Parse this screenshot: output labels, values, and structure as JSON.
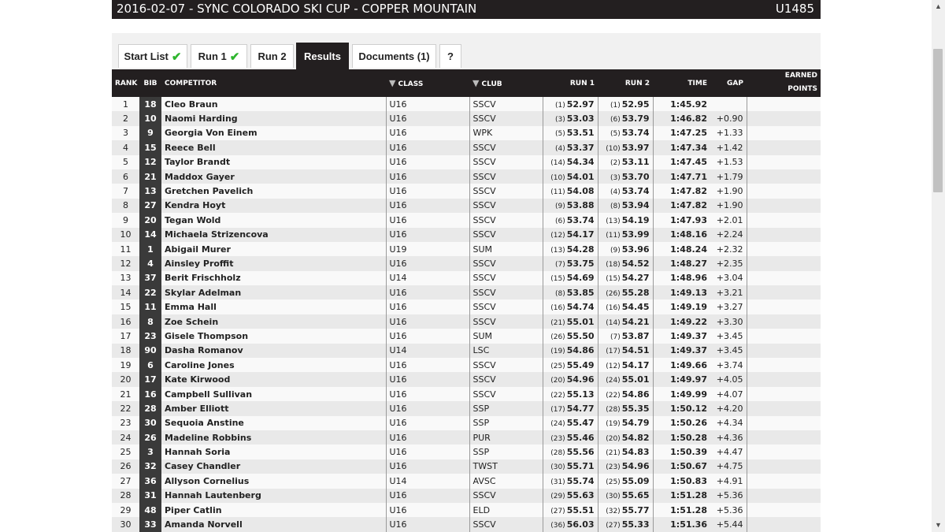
{
  "header": {
    "title": "2016-02-07 - SYNC COLORADO SKI CUP - COPPER MOUNTAIN",
    "code": "U1485"
  },
  "tabs": [
    {
      "label": "Start List",
      "check": "✔",
      "active": false
    },
    {
      "label": "Run 1",
      "check": "✔",
      "active": false
    },
    {
      "label": "Run 2",
      "check": "",
      "active": false
    },
    {
      "label": "Results",
      "check": "",
      "active": true
    },
    {
      "label": "Documents (1)",
      "check": "",
      "active": false
    },
    {
      "label": "?",
      "check": "",
      "active": false
    }
  ],
  "columns": {
    "rank": "RANK",
    "bib": "BIB",
    "competitor": "COMPETITOR",
    "class": "CLASS",
    "club": "CLUB",
    "run1": "RUN 1",
    "run2": "RUN 2",
    "time": "TIME",
    "gap": "GAP",
    "points_line1": "EARNED",
    "points_line2": "POINTS"
  },
  "icons": {
    "filter": "filter-funnel-icon",
    "check": "checkmark-icon"
  },
  "colors": {
    "header_bg": "#231f20",
    "check_green": "#2db52d",
    "bib_bg": "#3a3a3a"
  },
  "rows": [
    {
      "rank": "1",
      "bib": "18",
      "name": "Cleo Braun",
      "cls": "U16",
      "club": "SSCV",
      "r1p": "(1)",
      "r1": "52.97",
      "r2p": "(1)",
      "r2": "52.95",
      "time": "1:45.92",
      "gap": ""
    },
    {
      "rank": "2",
      "bib": "10",
      "name": "Naomi Harding",
      "cls": "U16",
      "club": "SSCV",
      "r1p": "(3)",
      "r1": "53.03",
      "r2p": "(6)",
      "r2": "53.79",
      "time": "1:46.82",
      "gap": "+0.90"
    },
    {
      "rank": "3",
      "bib": "9",
      "name": "Georgia Von Einem",
      "cls": "U16",
      "club": "WPK",
      "r1p": "(5)",
      "r1": "53.51",
      "r2p": "(5)",
      "r2": "53.74",
      "time": "1:47.25",
      "gap": "+1.33"
    },
    {
      "rank": "4",
      "bib": "15",
      "name": "Reece Bell",
      "cls": "U16",
      "club": "SSCV",
      "r1p": "(4)",
      "r1": "53.37",
      "r2p": "(10)",
      "r2": "53.97",
      "time": "1:47.34",
      "gap": "+1.42"
    },
    {
      "rank": "5",
      "bib": "12",
      "name": "Taylor Brandt",
      "cls": "U16",
      "club": "SSCV",
      "r1p": "(14)",
      "r1": "54.34",
      "r2p": "(2)",
      "r2": "53.11",
      "time": "1:47.45",
      "gap": "+1.53"
    },
    {
      "rank": "6",
      "bib": "21",
      "name": "Maddox Gayer",
      "cls": "U16",
      "club": "SSCV",
      "r1p": "(10)",
      "r1": "54.01",
      "r2p": "(3)",
      "r2": "53.70",
      "time": "1:47.71",
      "gap": "+1.79"
    },
    {
      "rank": "7",
      "bib": "13",
      "name": "Gretchen Pavelich",
      "cls": "U16",
      "club": "SSCV",
      "r1p": "(11)",
      "r1": "54.08",
      "r2p": "(4)",
      "r2": "53.74",
      "time": "1:47.82",
      "gap": "+1.90"
    },
    {
      "rank": "8",
      "bib": "27",
      "name": "Kendra Hoyt",
      "cls": "U16",
      "club": "SSCV",
      "r1p": "(9)",
      "r1": "53.88",
      "r2p": "(8)",
      "r2": "53.94",
      "time": "1:47.82",
      "gap": "+1.90"
    },
    {
      "rank": "9",
      "bib": "20",
      "name": "Tegan Wold",
      "cls": "U16",
      "club": "SSCV",
      "r1p": "(6)",
      "r1": "53.74",
      "r2p": "(13)",
      "r2": "54.19",
      "time": "1:47.93",
      "gap": "+2.01"
    },
    {
      "rank": "10",
      "bib": "14",
      "name": "Michaela Strizencova",
      "cls": "U16",
      "club": "SSCV",
      "r1p": "(12)",
      "r1": "54.17",
      "r2p": "(11)",
      "r2": "53.99",
      "time": "1:48.16",
      "gap": "+2.24"
    },
    {
      "rank": "11",
      "bib": "1",
      "name": "Abigail Murer",
      "cls": "U19",
      "club": "SUM",
      "r1p": "(13)",
      "r1": "54.28",
      "r2p": "(9)",
      "r2": "53.96",
      "time": "1:48.24",
      "gap": "+2.32"
    },
    {
      "rank": "12",
      "bib": "4",
      "name": "Ainsley Proffit",
      "cls": "U16",
      "club": "SSCV",
      "r1p": "(7)",
      "r1": "53.75",
      "r2p": "(18)",
      "r2": "54.52",
      "time": "1:48.27",
      "gap": "+2.35"
    },
    {
      "rank": "13",
      "bib": "37",
      "name": "Berit Frischholz",
      "cls": "U14",
      "club": "SSCV",
      "r1p": "(15)",
      "r1": "54.69",
      "r2p": "(15)",
      "r2": "54.27",
      "time": "1:48.96",
      "gap": "+3.04"
    },
    {
      "rank": "14",
      "bib": "22",
      "name": "Skylar Adelman",
      "cls": "U16",
      "club": "SSCV",
      "r1p": "(8)",
      "r1": "53.85",
      "r2p": "(26)",
      "r2": "55.28",
      "time": "1:49.13",
      "gap": "+3.21"
    },
    {
      "rank": "15",
      "bib": "11",
      "name": "Emma Hall",
      "cls": "U16",
      "club": "SSCV",
      "r1p": "(16)",
      "r1": "54.74",
      "r2p": "(16)",
      "r2": "54.45",
      "time": "1:49.19",
      "gap": "+3.27"
    },
    {
      "rank": "16",
      "bib": "8",
      "name": "Zoe Schein",
      "cls": "U16",
      "club": "SSCV",
      "r1p": "(21)",
      "r1": "55.01",
      "r2p": "(14)",
      "r2": "54.21",
      "time": "1:49.22",
      "gap": "+3.30"
    },
    {
      "rank": "17",
      "bib": "23",
      "name": "Gisele Thompson",
      "cls": "U16",
      "club": "SUM",
      "r1p": "(26)",
      "r1": "55.50",
      "r2p": "(7)",
      "r2": "53.87",
      "time": "1:49.37",
      "gap": "+3.45"
    },
    {
      "rank": "18",
      "bib": "90",
      "name": "Dasha Romanov",
      "cls": "U14",
      "club": "LSC",
      "r1p": "(19)",
      "r1": "54.86",
      "r2p": "(17)",
      "r2": "54.51",
      "time": "1:49.37",
      "gap": "+3.45"
    },
    {
      "rank": "19",
      "bib": "6",
      "name": "Caroline Jones",
      "cls": "U16",
      "club": "SSCV",
      "r1p": "(25)",
      "r1": "55.49",
      "r2p": "(12)",
      "r2": "54.17",
      "time": "1:49.66",
      "gap": "+3.74"
    },
    {
      "rank": "20",
      "bib": "17",
      "name": "Kate Kirwood",
      "cls": "U16",
      "club": "SSCV",
      "r1p": "(20)",
      "r1": "54.96",
      "r2p": "(24)",
      "r2": "55.01",
      "time": "1:49.97",
      "gap": "+4.05"
    },
    {
      "rank": "21",
      "bib": "16",
      "name": "Campbell Sullivan",
      "cls": "U16",
      "club": "SSCV",
      "r1p": "(22)",
      "r1": "55.13",
      "r2p": "(22)",
      "r2": "54.86",
      "time": "1:49.99",
      "gap": "+4.07"
    },
    {
      "rank": "22",
      "bib": "28",
      "name": "Amber Elliott",
      "cls": "U16",
      "club": "SSP",
      "r1p": "(17)",
      "r1": "54.77",
      "r2p": "(28)",
      "r2": "55.35",
      "time": "1:50.12",
      "gap": "+4.20"
    },
    {
      "rank": "23",
      "bib": "30",
      "name": "Sequoia Anstine",
      "cls": "U16",
      "club": "SSP",
      "r1p": "(24)",
      "r1": "55.47",
      "r2p": "(19)",
      "r2": "54.79",
      "time": "1:50.26",
      "gap": "+4.34"
    },
    {
      "rank": "24",
      "bib": "26",
      "name": "Madeline Robbins",
      "cls": "U16",
      "club": "PUR",
      "r1p": "(23)",
      "r1": "55.46",
      "r2p": "(20)",
      "r2": "54.82",
      "time": "1:50.28",
      "gap": "+4.36"
    },
    {
      "rank": "25",
      "bib": "3",
      "name": "Hannah Soria",
      "cls": "U16",
      "club": "SSP",
      "r1p": "(28)",
      "r1": "55.56",
      "r2p": "(21)",
      "r2": "54.83",
      "time": "1:50.39",
      "gap": "+4.47"
    },
    {
      "rank": "26",
      "bib": "32",
      "name": "Casey Chandler",
      "cls": "U16",
      "club": "TWST",
      "r1p": "(30)",
      "r1": "55.71",
      "r2p": "(23)",
      "r2": "54.96",
      "time": "1:50.67",
      "gap": "+4.75"
    },
    {
      "rank": "27",
      "bib": "36",
      "name": "Allyson Cornelius",
      "cls": "U14",
      "club": "AVSC",
      "r1p": "(31)",
      "r1": "55.74",
      "r2p": "(25)",
      "r2": "55.09",
      "time": "1:50.83",
      "gap": "+4.91"
    },
    {
      "rank": "28",
      "bib": "31",
      "name": "Hannah Lautenberg",
      "cls": "U16",
      "club": "SSCV",
      "r1p": "(29)",
      "r1": "55.63",
      "r2p": "(30)",
      "r2": "55.65",
      "time": "1:51.28",
      "gap": "+5.36"
    },
    {
      "rank": "29",
      "bib": "48",
      "name": "Piper Catlin",
      "cls": "U16",
      "club": "ELD",
      "r1p": "(27)",
      "r1": "55.51",
      "r2p": "(32)",
      "r2": "55.77",
      "time": "1:51.28",
      "gap": "+5.36"
    },
    {
      "rank": "30",
      "bib": "33",
      "name": "Amanda Norvell",
      "cls": "U16",
      "club": "SSCV",
      "r1p": "(36)",
      "r1": "56.03",
      "r2p": "(27)",
      "r2": "55.33",
      "time": "1:51.36",
      "gap": "+5.44"
    }
  ]
}
